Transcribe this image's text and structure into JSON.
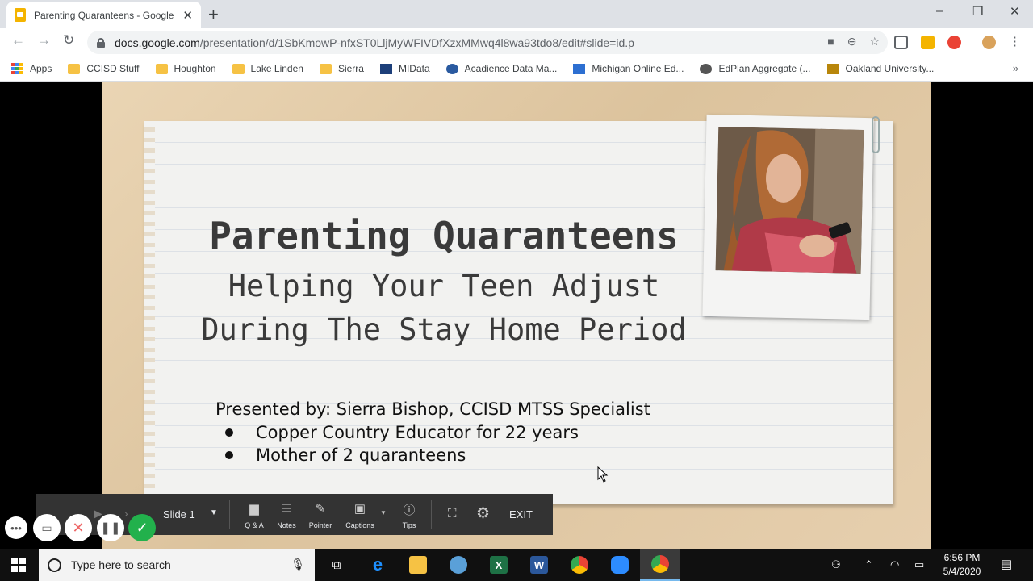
{
  "browser": {
    "tab_title": "Parenting Quaranteens - Google",
    "tab_close": "✕",
    "new_tab": "+",
    "url_host": "docs.google.com",
    "url_path": "/presentation/d/1SbKmowP-nfxST0LljMyWFIVDfXzxMMwq4l8wa93tdo8/edit#slide=id.p",
    "window_controls": [
      "–",
      "❐",
      "✕"
    ]
  },
  "bookmarks": {
    "items": [
      {
        "label": "Apps",
        "icon": "apps-grid-icon"
      },
      {
        "label": "CCISD Stuff",
        "icon": "folder-icon"
      },
      {
        "label": "Houghton",
        "icon": "folder-icon"
      },
      {
        "label": "Lake Linden",
        "icon": "folder-icon"
      },
      {
        "label": "Sierra",
        "icon": "folder-icon"
      },
      {
        "label": "MIData",
        "icon": "midata-icon"
      },
      {
        "label": "Acadience Data Ma...",
        "icon": "globe-icon"
      },
      {
        "label": "Michigan Online Ed...",
        "icon": "star-badge-icon"
      },
      {
        "label": "EdPlan Aggregate (...",
        "icon": "globe-icon"
      },
      {
        "label": "Oakland University...",
        "icon": "oakland-icon"
      }
    ],
    "more": "»"
  },
  "slide": {
    "title": "Parenting Quaranteens",
    "subtitle_line1": "Helping Your Teen Adjust",
    "subtitle_line2": "During The Stay Home Period",
    "presenter": "Presented by: Sierra Bishop, CCISD MTSS Specialist",
    "bullets": [
      "Copper Country Educator for 22 years",
      "Mother of 2 quaranteens"
    ]
  },
  "presenter_controls": {
    "slide_label": "Slide 1",
    "buttons": [
      {
        "label": "Q & A",
        "icon": "qa-icon"
      },
      {
        "label": "Notes",
        "icon": "notes-icon"
      },
      {
        "label": "Pointer",
        "icon": "pointer-icon"
      },
      {
        "label": "Captions",
        "icon": "captions-icon"
      },
      {
        "label": "Tips",
        "icon": "info-icon"
      }
    ],
    "exit_label": "EXIT"
  },
  "taskbar": {
    "search_placeholder": "Type here to search",
    "time": "6:56 PM",
    "date": "5/4/2020"
  },
  "colors": {
    "accent_green": "#22b14c",
    "slide_background": "#e2c9a4",
    "toolbar_dark": "#333333"
  }
}
